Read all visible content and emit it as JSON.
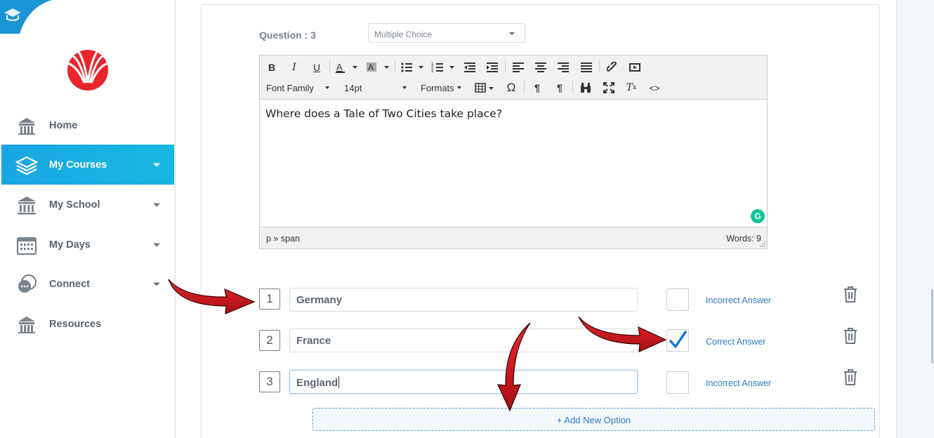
{
  "sidebar": {
    "items": [
      {
        "label": "Home",
        "icon": "school-building-icon",
        "has_caret": false,
        "active": false
      },
      {
        "label": "My Courses",
        "icon": "stacked-layers-icon",
        "has_caret": true,
        "active": true
      },
      {
        "label": "My School",
        "icon": "columns-building-icon",
        "has_caret": true,
        "active": false
      },
      {
        "label": "My Days",
        "icon": "calendar-icon",
        "has_caret": true,
        "active": false
      },
      {
        "label": "Connect",
        "icon": "chat-bubbles-icon",
        "has_caret": true,
        "active": false
      },
      {
        "label": "Resources",
        "icon": "library-building-icon",
        "has_caret": false,
        "active": false
      }
    ]
  },
  "question": {
    "label": "Question : 3",
    "type": "Multiple Choice"
  },
  "editor": {
    "toolbar": {
      "font_family": "Font Family",
      "font_size": "14pt",
      "formats": "Formats"
    },
    "content": "Where does a Tale of Two Cities take place?",
    "status_path": "p » span",
    "word_count": "Words: 9"
  },
  "options": [
    {
      "number": "1",
      "value": "Germany",
      "checked": false,
      "status": "Incorrect Answer"
    },
    {
      "number": "2",
      "value": "France",
      "checked": true,
      "status": "Correct Answer"
    },
    {
      "number": "3",
      "value": "England",
      "checked": false,
      "status": "Incorrect Answer"
    }
  ],
  "add_option": {
    "label": "+ Add New Option"
  },
  "colors": {
    "accent": "#1aa5e3",
    "link": "#2f78c4",
    "annotation_arrow": "#d71920",
    "logo": "#e8262b"
  }
}
